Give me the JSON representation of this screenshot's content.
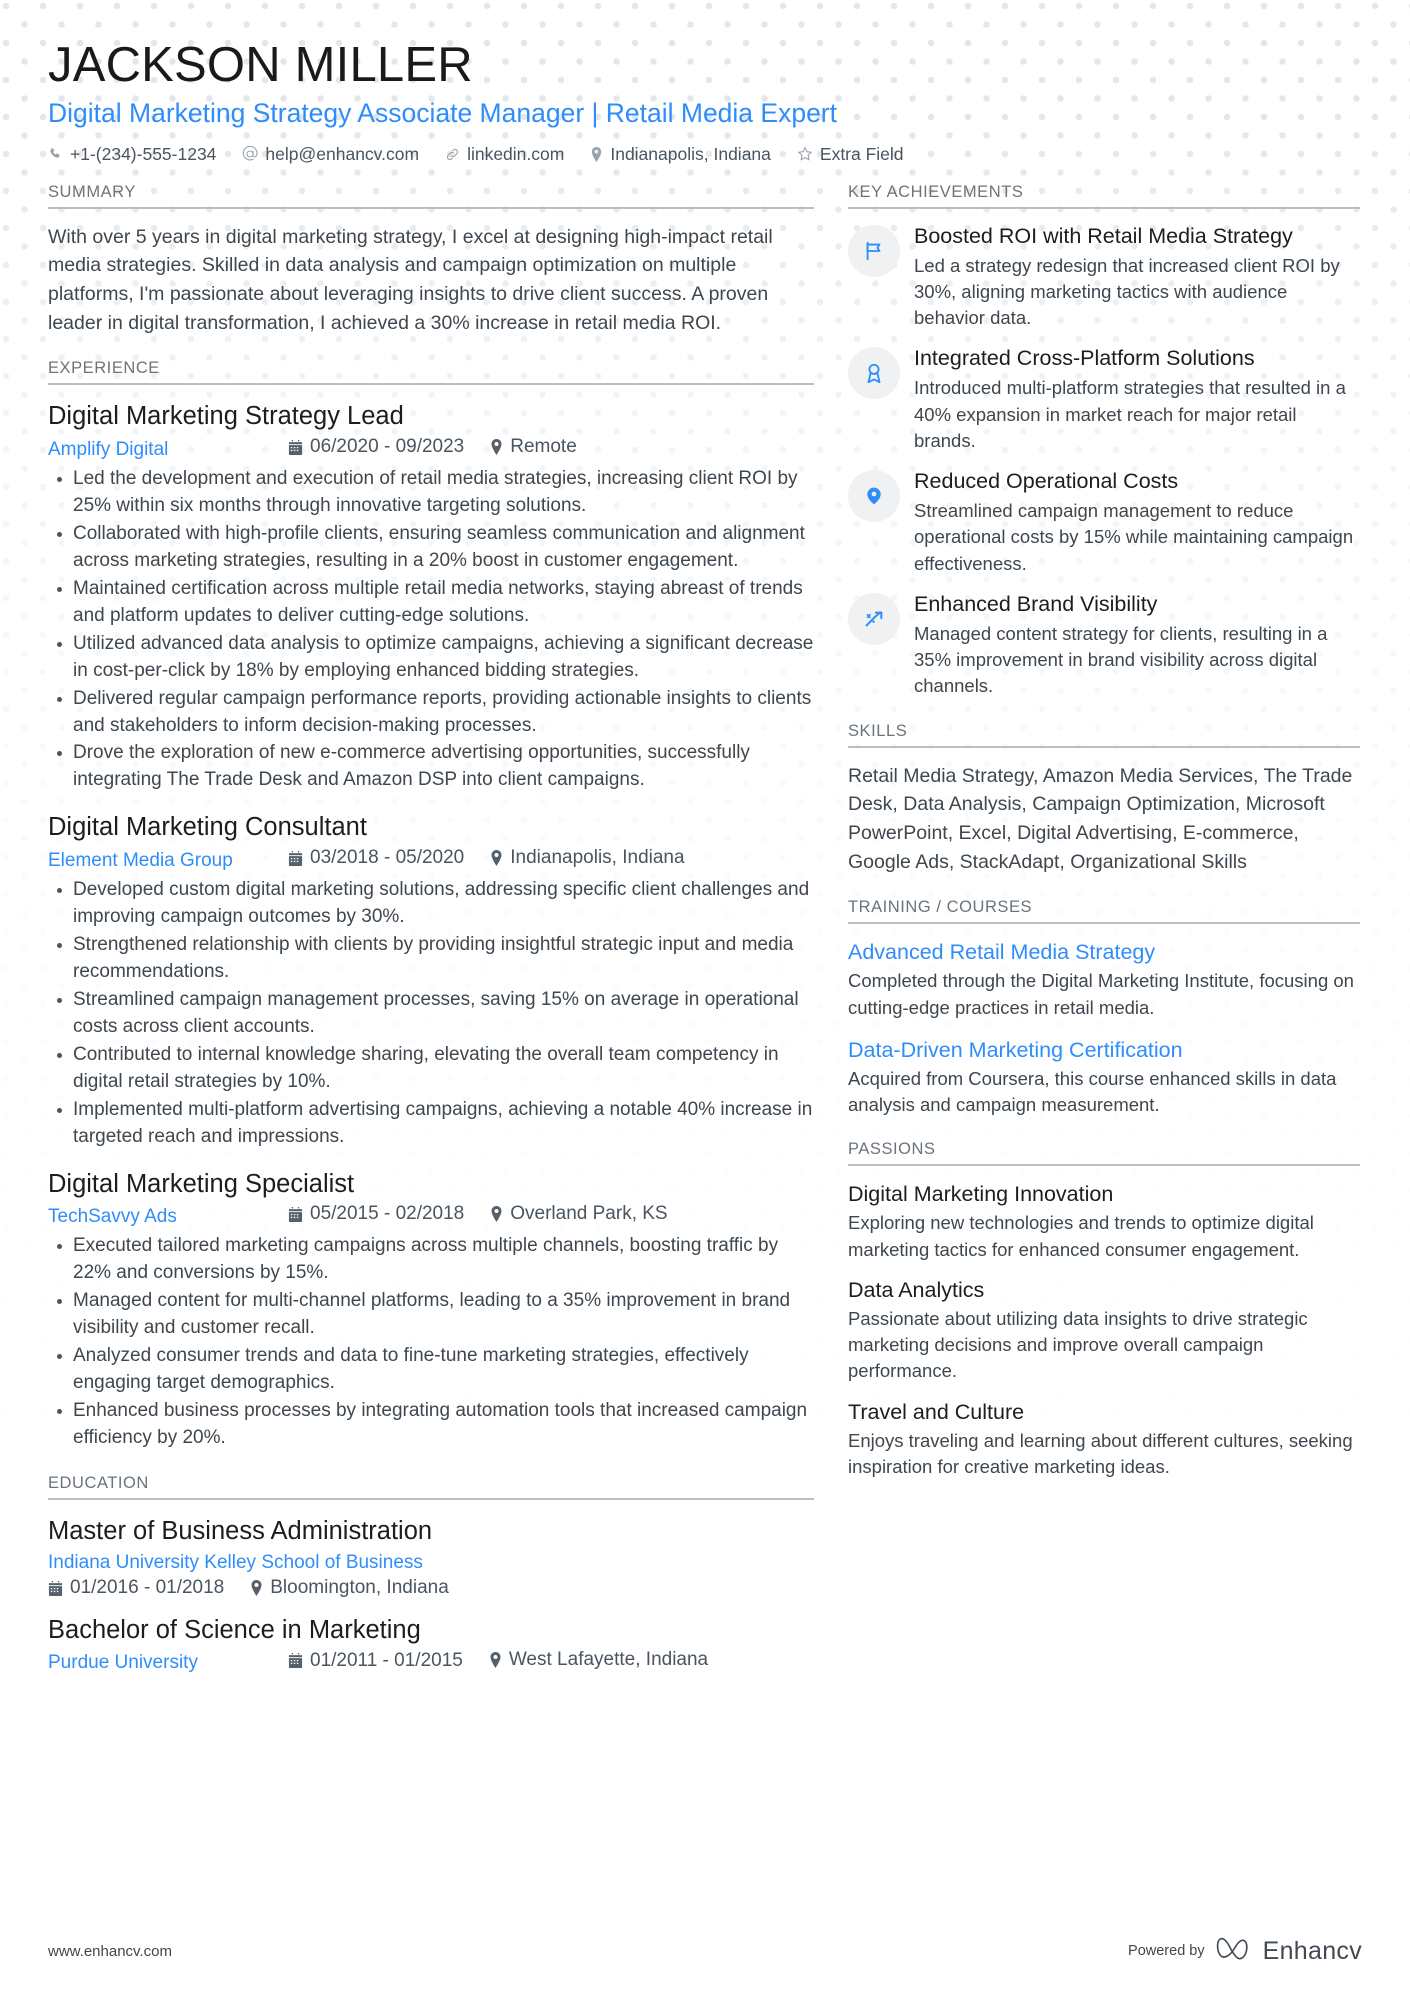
{
  "header": {
    "name": "JACKSON MILLER",
    "headline": "Digital Marketing Strategy Associate Manager | Retail Media Expert",
    "contacts": [
      {
        "icon": "phone-icon",
        "text": "+1-(234)-555-1234"
      },
      {
        "icon": "at-email-icon",
        "text": "help@enhancv.com"
      },
      {
        "icon": "link-icon",
        "text": "linkedin.com"
      },
      {
        "icon": "location-pin-icon",
        "text": "Indianapolis, Indiana"
      },
      {
        "icon": "star-icon",
        "text": "Extra Field"
      }
    ]
  },
  "summary": {
    "title": "SUMMARY",
    "text": "With over 5 years in digital marketing strategy, I excel at designing high-impact retail media strategies. Skilled in data analysis and campaign optimization on multiple platforms, I'm passionate about leveraging insights to drive client success. A proven leader in digital transformation, I achieved a 30% increase in retail media ROI."
  },
  "experience": {
    "title": "EXPERIENCE",
    "jobs": [
      {
        "role": "Digital Marketing Strategy Lead",
        "company": "Amplify Digital",
        "dates": "06/2020 - 09/2023",
        "location": "Remote",
        "bullets": [
          "Led the development and execution of retail media strategies, increasing client ROI by 25% within six months through innovative targeting solutions.",
          "Collaborated with high-profile clients, ensuring seamless communication and alignment across marketing strategies, resulting in a 20% boost in customer engagement.",
          "Maintained certification across multiple retail media networks, staying abreast of trends and platform updates to deliver cutting-edge solutions.",
          "Utilized advanced data analysis to optimize campaigns, achieving a significant decrease in cost-per-click by 18% by employing enhanced bidding strategies.",
          "Delivered regular campaign performance reports, providing actionable insights to clients and stakeholders to inform decision-making processes.",
          "Drove the exploration of new e-commerce advertising opportunities, successfully integrating The Trade Desk and Amazon DSP into client campaigns."
        ]
      },
      {
        "role": "Digital Marketing Consultant",
        "company": "Element Media Group",
        "dates": "03/2018 - 05/2020",
        "location": "Indianapolis, Indiana",
        "bullets": [
          "Developed custom digital marketing solutions, addressing specific client challenges and improving campaign outcomes by 30%.",
          "Strengthened relationship with clients by providing insightful strategic input and media recommendations.",
          "Streamlined campaign management processes, saving 15% on average in operational costs across client accounts.",
          "Contributed to internal knowledge sharing, elevating the overall team competency in digital retail strategies by 10%.",
          "Implemented multi-platform advertising campaigns, achieving a notable 40% increase in targeted reach and impressions."
        ]
      },
      {
        "role": "Digital Marketing Specialist",
        "company": "TechSavvy Ads",
        "dates": "05/2015 - 02/2018",
        "location": "Overland Park, KS",
        "bullets": [
          "Executed tailored marketing campaigns across multiple channels, boosting traffic by 22% and conversions by 15%.",
          "Managed content for multi-channel platforms, leading to a 35% improvement in brand visibility and customer recall.",
          "Analyzed consumer trends and data to fine-tune marketing strategies, effectively engaging target demographics.",
          "Enhanced business processes by integrating automation tools that increased campaign efficiency by 20%."
        ]
      }
    ]
  },
  "education": {
    "title": "EDUCATION",
    "items": [
      {
        "degree": "Master of Business Administration",
        "school": "Indiana University Kelley School of Business",
        "dates": "01/2016 - 01/2018",
        "location": "Bloomington, Indiana",
        "layout": "stacked"
      },
      {
        "degree": "Bachelor of Science in Marketing",
        "school": "Purdue University",
        "dates": "01/2011 - 01/2015",
        "location": "West Lafayette, Indiana",
        "layout": "inline"
      }
    ]
  },
  "achievements": {
    "title": "KEY ACHIEVEMENTS",
    "items": [
      {
        "icon": "flag-icon",
        "title": "Boosted ROI with Retail Media Strategy",
        "desc": "Led a strategy redesign that increased client ROI by 30%, aligning marketing tactics with audience behavior data."
      },
      {
        "icon": "award-medal-icon",
        "title": "Integrated Cross-Platform Solutions",
        "desc": "Introduced multi-platform strategies that resulted in a 40% expansion in market reach for major retail brands."
      },
      {
        "icon": "map-pin-icon",
        "title": "Reduced Operational Costs",
        "desc": "Streamlined campaign management to reduce operational costs by 15% while maintaining campaign effectiveness."
      },
      {
        "icon": "trending-arrow-icon",
        "title": "Enhanced Brand Visibility",
        "desc": "Managed content strategy for clients, resulting in a 35% improvement in brand visibility across digital channels."
      }
    ]
  },
  "skills": {
    "title": "SKILLS",
    "text": "Retail Media Strategy, Amazon Media Services, The Trade Desk, Data Analysis, Campaign Optimization, Microsoft PowerPoint, Excel, Digital Advertising, E-commerce, Google Ads, StackAdapt, Organizational Skills"
  },
  "training": {
    "title": "TRAINING / COURSES",
    "items": [
      {
        "name": "Advanced Retail Media Strategy",
        "desc": "Completed through the Digital Marketing Institute, focusing on cutting-edge practices in retail media."
      },
      {
        "name": "Data-Driven Marketing Certification",
        "desc": "Acquired from Coursera, this course enhanced skills in data analysis and campaign measurement."
      }
    ]
  },
  "passions": {
    "title": "PASSIONS",
    "items": [
      {
        "name": "Digital Marketing Innovation",
        "desc": "Exploring new technologies and trends to optimize digital marketing tactics for enhanced consumer engagement."
      },
      {
        "name": "Data Analytics",
        "desc": "Passionate about utilizing data insights to drive strategic marketing decisions and improve overall campaign performance."
      },
      {
        "name": "Travel and Culture",
        "desc": "Enjoys traveling and learning about different cultures, seeking inspiration for creative marketing ideas."
      }
    ]
  },
  "footer": {
    "url": "www.enhancv.com",
    "powered_by": "Powered by",
    "brand": "Enhancv"
  },
  "colors": {
    "accent": "#2f8dfa",
    "heading": "#1d1d1d",
    "body": "#3e474f",
    "section_label": "#6b747c",
    "rule": "#b9bfc4",
    "dot_pattern": "#e4e7e9",
    "icon_circle": "#f0f1f2"
  }
}
